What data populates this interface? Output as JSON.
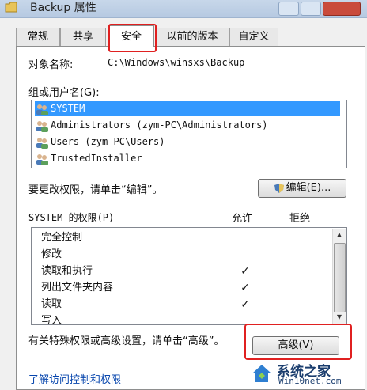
{
  "window": {
    "title": "Backup 属性"
  },
  "tabs": [
    "常规",
    "共享",
    "安全",
    "以前的版本",
    "自定义"
  ],
  "object": {
    "label": "对象名称:",
    "value": "C:\\Windows\\winsxs\\Backup"
  },
  "groups": {
    "label": "组或用户名(G):",
    "items": [
      "SYSTEM",
      "Administrators (zym-PC\\Administrators)",
      "Users (zym-PC\\Users)",
      "TrustedInstaller"
    ]
  },
  "edit": {
    "hint": "要更改权限，请单击“编辑”。",
    "button": "编辑(E)..."
  },
  "permissions": {
    "label": "SYSTEM 的权限(P)",
    "allow": "允许",
    "deny": "拒绝",
    "rows": [
      {
        "name": "完全控制",
        "allow": "",
        "deny": ""
      },
      {
        "name": "修改",
        "allow": "",
        "deny": ""
      },
      {
        "name": "读取和执行",
        "allow": "✓",
        "deny": ""
      },
      {
        "name": "列出文件夹内容",
        "allow": "✓",
        "deny": ""
      },
      {
        "name": "读取",
        "allow": "✓",
        "deny": ""
      },
      {
        "name": "写入",
        "allow": "",
        "deny": ""
      }
    ]
  },
  "advanced": {
    "hint": "有关特殊权限或高级设置，请单击“高级”。",
    "button": "高级(V)"
  },
  "link": "了解访问控制和权限",
  "watermark": {
    "name": "系统之家",
    "url": "Win10net.com"
  },
  "colors": {
    "selection": "#3399ff",
    "highlight": "#e02020",
    "link": "#0645ad"
  }
}
